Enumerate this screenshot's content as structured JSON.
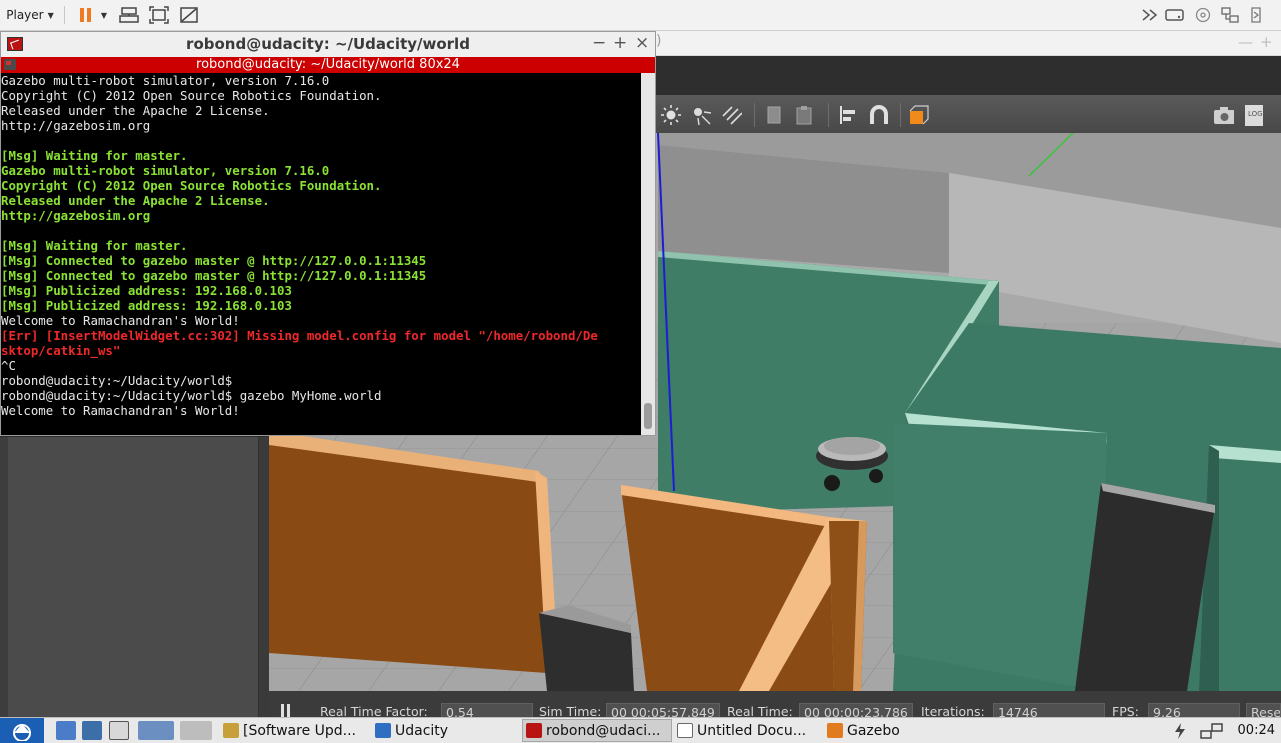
{
  "player": {
    "menu_label": "Player"
  },
  "gazebo": {
    "status": {
      "real_time_factor_label": "Real Time Factor:",
      "real_time_factor_value": "0.54",
      "sim_time_label": "Sim Time:",
      "sim_time_value": "00 00:05:57.849",
      "real_time_label": "Real Time:",
      "real_time_value": "00 00:00:23.786",
      "iterations_label": "Iterations:",
      "iterations_value": "14746",
      "fps_label": "FPS:",
      "fps_value": "9.26",
      "reset_label": "Reset"
    }
  },
  "terminal": {
    "window_title": "robond@udacity: ~/Udacity/world",
    "tab_title": "robond@udacity: ~/Udacity/world 80x24",
    "lines": [
      {
        "text": "Gazebo multi-robot simulator, version 7.16.0",
        "color": "white"
      },
      {
        "text": "Copyright (C) 2012 Open Source Robotics Foundation.",
        "color": "white"
      },
      {
        "text": "Released under the Apache 2 License.",
        "color": "white"
      },
      {
        "text": "http://gazebosim.org",
        "color": "white"
      },
      {
        "text": "",
        "color": "white"
      },
      {
        "text": "[Msg] Waiting for master.",
        "color": "green"
      },
      {
        "text": "Gazebo multi-robot simulator, version 7.16.0",
        "color": "green"
      },
      {
        "text": "Copyright (C) 2012 Open Source Robotics Foundation.",
        "color": "green"
      },
      {
        "text": "Released under the Apache 2 License.",
        "color": "green"
      },
      {
        "text": "http://gazebosim.org",
        "color": "green"
      },
      {
        "text": "",
        "color": "white"
      },
      {
        "text": "[Msg] Waiting for master.",
        "color": "green"
      },
      {
        "text": "[Msg] Connected to gazebo master @ http://127.0.0.1:11345",
        "color": "green"
      },
      {
        "text": "[Msg] Connected to gazebo master @ http://127.0.0.1:11345",
        "color": "green"
      },
      {
        "text": "[Msg] Publicized address: 192.168.0.103",
        "color": "green"
      },
      {
        "text": "[Msg] Publicized address: 192.168.0.103",
        "color": "green"
      },
      {
        "text": "Welcome to Ramachandran's World!",
        "color": "white"
      },
      {
        "text": "[Err] [InsertModelWidget.cc:302] Missing model.config for model \"/home/robond/De",
        "color": "red"
      },
      {
        "text": "sktop/catkin_ws\"",
        "color": "red"
      },
      {
        "text": "^C",
        "color": "white"
      },
      {
        "text": "robond@udacity:~/Udacity/world$",
        "color": "white"
      },
      {
        "text": "robond@udacity:~/Udacity/world$ gazebo MyHome.world",
        "color": "white"
      },
      {
        "text": "Welcome to Ramachandran's World!",
        "color": "white"
      }
    ]
  },
  "taskbar": {
    "tasks": [
      {
        "label": "[Software Upd...",
        "icon_color": "#c8a03a"
      },
      {
        "label": "Udacity",
        "icon_color": "#2f6fc2"
      },
      {
        "label": "robond@udaci...",
        "icon_color": "#b81414"
      },
      {
        "label": "Untitled Docu...",
        "icon_color": "#6a6a6a"
      },
      {
        "label": "Gazebo",
        "icon_color": "#e07b20"
      }
    ],
    "clock": "00:24"
  }
}
